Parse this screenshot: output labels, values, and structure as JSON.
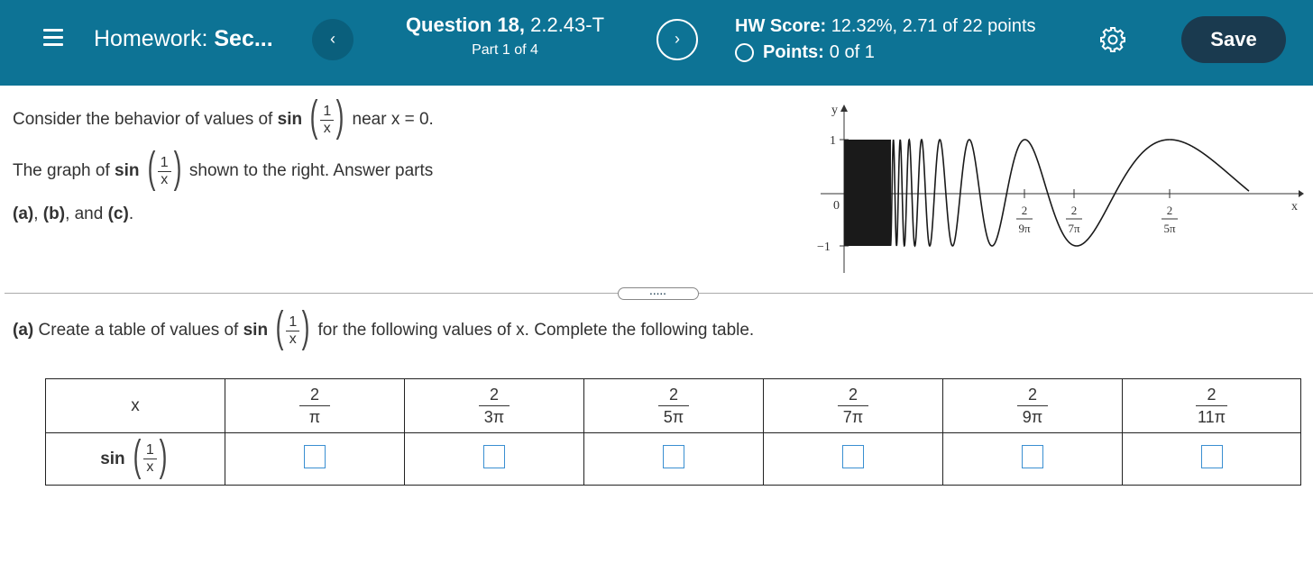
{
  "header": {
    "menu_icon": "hamburger-menu-icon",
    "hw_label": "Homework:",
    "hw_name": "Sec...",
    "prev_label": "‹",
    "next_label": "›",
    "question_label": "Question 18,",
    "question_code": "2.2.43-T",
    "part": "Part 1 of 4",
    "hw_score_label": "HW Score:",
    "hw_score_value": "12.32%, 2.71 of 22 points",
    "points_label": "Points:",
    "points_value": "0 of 1",
    "settings_icon": "gear-icon",
    "save_label": "Save"
  },
  "intro": {
    "consider_prefix": "Consider the behavior of values of",
    "func_name": "sin",
    "frac_num": "1",
    "frac_den": "x",
    "consider_suffix": "near x = 0.",
    "graph_prefix": "The graph of",
    "graph_suffix": "shown to the right. Answer parts",
    "parts_a": "(a)",
    "parts_sep1": ",",
    "parts_b": "(b)",
    "parts_sep2": ", and",
    "parts_c": "(c)",
    "parts_end": "."
  },
  "graph": {
    "y_axis_label": "y",
    "x_axis_label": "x",
    "y_tick_1": "1",
    "y_tick_0": "0",
    "y_tick_neg1": "−1",
    "x_ticks": [
      {
        "num": "2",
        "den": "9π"
      },
      {
        "num": "2",
        "den": "7π"
      },
      {
        "num": "2",
        "den": "5π"
      }
    ]
  },
  "divider_handle": ".....",
  "part_a": {
    "label": "(a)",
    "text_prefix": "Create a table of values of",
    "text_suffix": "for the following values of x. Complete the following table."
  },
  "table": {
    "row1_header": "x",
    "row2_header": "sin",
    "columns": [
      {
        "num": "2",
        "den": "π",
        "answer": ""
      },
      {
        "num": "2",
        "den": "3π",
        "answer": ""
      },
      {
        "num": "2",
        "den": "5π",
        "answer": ""
      },
      {
        "num": "2",
        "den": "7π",
        "answer": ""
      },
      {
        "num": "2",
        "den": "9π",
        "answer": ""
      },
      {
        "num": "2",
        "den": "11π",
        "answer": ""
      }
    ]
  }
}
